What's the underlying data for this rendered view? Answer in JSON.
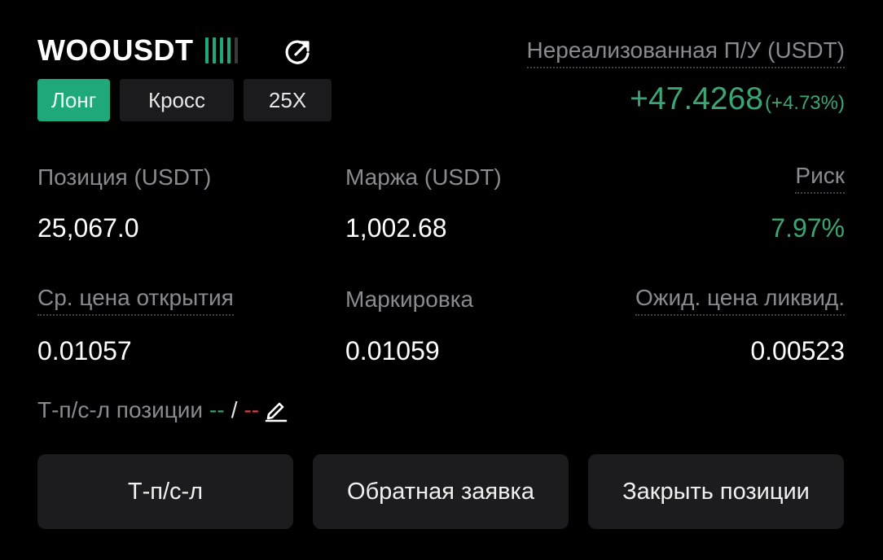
{
  "header": {
    "symbol": "WOOUSDT",
    "signal_icon": "signal-strength-icon",
    "signal_colors": [
      "#1fa97b",
      "#1fa97b",
      "#1fa97b",
      "#1fa97b",
      "#3a3a3e"
    ],
    "share_icon": "share-icon"
  },
  "tags": {
    "side": "Лонг",
    "margin_mode": "Кросс",
    "leverage": "25X"
  },
  "pnl": {
    "label": "Нереализованная П/У (USDT)",
    "value": "+47.4268",
    "percent": "(+4.73%)"
  },
  "stats": {
    "position_label": "Позиция (USDT)",
    "position_value": "25,067.0",
    "margin_label": "Маржа (USDT)",
    "margin_value": "1,002.68",
    "risk_label": "Риск",
    "risk_value": "7.97%",
    "entry_label": "Ср. цена открытия",
    "entry_value": "0.01057",
    "mark_label": "Маркировка",
    "mark_value": "0.01059",
    "liq_label": "Ожид. цена ликвид.",
    "liq_value": "0.00523"
  },
  "tpsl": {
    "label": "Т-п/с-л позиции",
    "tp": "--",
    "slash": "/",
    "sl": "--",
    "edit_icon": "edit-pencil-icon"
  },
  "actions": {
    "tpsl_button": "Т-п/с-л",
    "reverse_button": "Обратная заявка",
    "close_button": "Закрыть позиции"
  },
  "colors": {
    "accent_green": "#1fa97b",
    "profit_green": "#3aa675",
    "loss_red": "#e0413d",
    "muted_text": "#8a8a8f",
    "button_bg": "#1c1c1e"
  }
}
